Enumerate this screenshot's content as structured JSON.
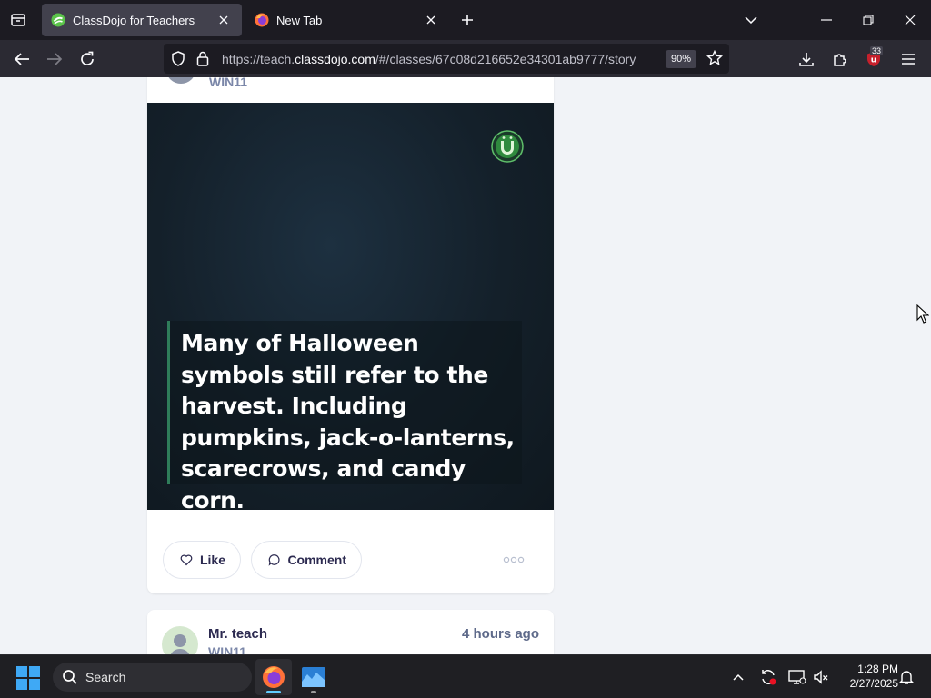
{
  "browser": {
    "tabs": [
      {
        "title": "ClassDojo for Teachers",
        "active": true,
        "favicon": "classdojo-favicon"
      },
      {
        "title": "New Tab",
        "active": false,
        "favicon": "firefox-favicon"
      }
    ],
    "url_prefix": "https://teach.",
    "url_host": "classdojo.com",
    "url_path": "/#/classes/67c08d216652e34301ab9777/story",
    "zoom": "90%",
    "extension_badge": "33",
    "colors": {
      "tabstrip": "#1c1b22",
      "navbar": "#2b2a33",
      "active_tab": "#42414d"
    }
  },
  "post": {
    "class_name": "WIN11",
    "caption": "Many of Halloween symbols still refer to the harvest. Including pumpkins, jack-o-lanterns, scarecrows, and candy corn.",
    "like_label": "Like",
    "comment_label": "Comment"
  },
  "next_post": {
    "author": "Mr. teach",
    "class_name": "WIN11",
    "time": "4 hours ago"
  },
  "taskbar": {
    "search_label": "Search",
    "time": "1:28 PM",
    "date": "2/27/2025",
    "pinned": [
      "firefox-icon",
      "app-icon"
    ]
  }
}
